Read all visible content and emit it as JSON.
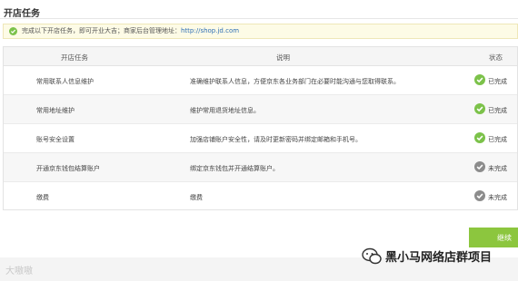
{
  "header": {
    "title": "开店任务"
  },
  "notice": {
    "text": "完成以下开店任务，即可开业大吉；商家后台管理地址：",
    "url": "http://shop.jd.com"
  },
  "table": {
    "columns": [
      "开店任务",
      "说明",
      "状态"
    ],
    "rows": [
      {
        "task": "常用联系人信息维护",
        "desc": "准确维护联系人信息，方便京东各业务部门在必要时能沟通与您取得联系。",
        "status": "已完成",
        "done": true
      },
      {
        "task": "常用地址维护",
        "desc": "维护常用退货地址信息。",
        "status": "已完成",
        "done": true
      },
      {
        "task": "账号安全设置",
        "desc": "加强店铺账户安全性，请及时更新密码并绑定邮箱和手机号。",
        "status": "已完成",
        "done": true
      },
      {
        "task": "开通京东钱包结算账户",
        "desc": "绑定京东钱包并开通结算账户。",
        "status": "未完成",
        "done": false
      },
      {
        "task": "缴费",
        "desc": "缴费",
        "status": "未完成",
        "done": false
      }
    ]
  },
  "actions": {
    "continue_label": "继续"
  },
  "watermarks": {
    "left": "大嗷嗷",
    "right": "黑小马网络店群项目"
  },
  "colors": {
    "done": "#7cc24a",
    "pending": "#8c8c8c",
    "button": "#8cc63e",
    "link": "#2f6fb5"
  }
}
